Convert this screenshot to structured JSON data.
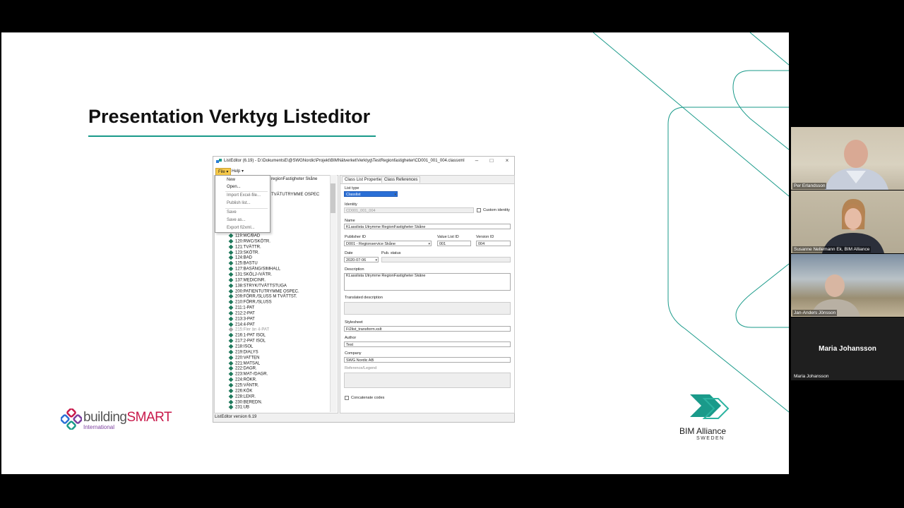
{
  "slide": {
    "title": "Presentation Verktyg Listeditor"
  },
  "app": {
    "window_title": "ListEditor (6.19) - D:\\DokumentsE\\@SWGNordic\\Projekt\\BIMNätverket\\Verktyg\\TestRegionfastigheter\\CD001_001_004.classxml",
    "menu": [
      "File",
      "Help"
    ],
    "file_menu": [
      "New",
      "Open...",
      "Import Excel-file...",
      "Publish list...",
      "Save",
      "Save as...",
      "Export fi2xml..."
    ],
    "tree_top": [
      "regionFastigheter Skåne",
      "TVÄTUTRYMME OSPEC"
    ],
    "tree": [
      {
        "label": "119:WC/BAD",
        "dim": false
      },
      {
        "label": "120:RWC/SKÖTR.",
        "dim": false
      },
      {
        "label": "121:TVÄTTR.",
        "dim": false
      },
      {
        "label": "123:SKÖTR.",
        "dim": false
      },
      {
        "label": "124:BAD",
        "dim": false
      },
      {
        "label": "125:BASTU",
        "dim": false
      },
      {
        "label": "127:BASÄNG/SIMHALL",
        "dim": false
      },
      {
        "label": "131:SKÖLJ-/VÄTR.",
        "dim": false
      },
      {
        "label": "137:MEDICINR.",
        "dim": false
      },
      {
        "label": "138:STRYK/TVÄTTSTUGA",
        "dim": false
      },
      {
        "label": "200:PATIENTUTRYMME OSPEC.",
        "dim": false
      },
      {
        "label": "209:FÖRR./SLUSS M TVÄTTST.",
        "dim": false
      },
      {
        "label": "210:FÖRR./SLUSS",
        "dim": false
      },
      {
        "label": "211:1-PAT",
        "dim": false
      },
      {
        "label": "212:2-PAT",
        "dim": false
      },
      {
        "label": "213:3-PAT",
        "dim": false
      },
      {
        "label": "214:4-PAT",
        "dim": false
      },
      {
        "label": "215:Fler än 4-PAT",
        "dim": true
      },
      {
        "label": "216:1-PAT ISOL",
        "dim": false
      },
      {
        "label": "217:2-PAT ISOL",
        "dim": false
      },
      {
        "label": "218:ISOL",
        "dim": false
      },
      {
        "label": "219:DIALYS",
        "dim": false
      },
      {
        "label": "220:VATTEN",
        "dim": false
      },
      {
        "label": "221:MATSAL",
        "dim": false
      },
      {
        "label": "222:DAGR.",
        "dim": false
      },
      {
        "label": "223:MAT-/DAGR.",
        "dim": false
      },
      {
        "label": "224:RÖKR.",
        "dim": false
      },
      {
        "label": "225:VÄNTR.",
        "dim": false
      },
      {
        "label": "226:KÖK",
        "dim": false
      },
      {
        "label": "228:LEKR.",
        "dim": false
      },
      {
        "label": "230:BEREDN.",
        "dim": false
      },
      {
        "label": "231:UB",
        "dim": false
      }
    ],
    "tabs": [
      "Class List Properties",
      "Class References"
    ],
    "form": {
      "list_type_label": "List type",
      "list_type_value": "Classlist",
      "identity_label": "Identity",
      "identity_value": "CD001_001_004",
      "custom_identity_label": "Custom identity",
      "name_label": "Name",
      "name_value": "KLasslista Utrymme RegionFastigheter Skåne",
      "publisher_label": "Publisher ID",
      "publisher_value": "D001 - Regionservice Skåne",
      "value_list_label": "Value List ID",
      "value_list_value": "001",
      "version_label": "Version ID",
      "version_value": "004",
      "date_label": "Date",
      "date_value": "2020-07-06",
      "pub_status_label": "Pub. status",
      "description_label": "Description",
      "description_value": "KLasslista Utrymme RegionFastigheter Skåne",
      "translated_label": "Translated description",
      "stylesheet_label": "Stylesheet",
      "stylesheet_value": "Fi2list_transform.xslt",
      "author_label": "Author",
      "author_value": "Test",
      "company_label": "Company",
      "company_value": "SWG Nordic AB",
      "reference_label": "Reference/Legend",
      "concatenate_label": "Concatenate codes"
    },
    "status": "ListEditor version 6.19"
  },
  "logos": {
    "buildingsmart_part1": "building",
    "buildingsmart_part2": "SMART",
    "buildingsmart_sub": "International",
    "bim_name": "BIM Alliance",
    "bim_country": "SWEDEN"
  },
  "participants": [
    {
      "name": "Per Erlandsson"
    },
    {
      "name": "Susanne Nellemann Ek, BIM Alliance"
    },
    {
      "name": "Jan-Anders Jönsson"
    },
    {
      "name": "Maria Johansson",
      "center_label": "Maria Johansson"
    }
  ],
  "colors": {
    "accent": "#1a9a8a",
    "menu_highlight": "#f6c94a",
    "selection": "#2a6fd6"
  }
}
